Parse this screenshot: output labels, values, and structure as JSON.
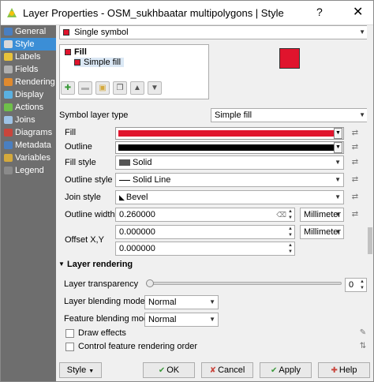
{
  "window": {
    "title": "Layer Properties - OSM_sukhbaatar multipolygons | Style",
    "help_glyph": "?",
    "close_glyph": "✕"
  },
  "sidebar": {
    "items": [
      {
        "label": "General",
        "icon": "info-icon",
        "active": false
      },
      {
        "label": "Style",
        "icon": "brush-icon",
        "active": true
      },
      {
        "label": "Labels",
        "icon": "labels-icon",
        "active": false
      },
      {
        "label": "Fields",
        "icon": "fields-icon",
        "active": false
      },
      {
        "label": "Rendering",
        "icon": "rendering-icon",
        "active": false
      },
      {
        "label": "Display",
        "icon": "display-icon",
        "active": false
      },
      {
        "label": "Actions",
        "icon": "actions-icon",
        "active": false
      },
      {
        "label": "Joins",
        "icon": "joins-icon",
        "active": false
      },
      {
        "label": "Diagrams",
        "icon": "diagrams-icon",
        "active": false
      },
      {
        "label": "Metadata",
        "icon": "metadata-icon",
        "active": false
      },
      {
        "label": "Variables",
        "icon": "variables-icon",
        "active": false
      },
      {
        "label": "Legend",
        "icon": "legend-icon",
        "active": false
      }
    ]
  },
  "renderer": {
    "selected": "Single symbol"
  },
  "symbol_tree": {
    "root_label": "Fill",
    "child_label": "Simple fill"
  },
  "preview_color": "#e0142d",
  "symbol_layer_type": {
    "label": "Symbol layer type",
    "value": "Simple fill"
  },
  "props": {
    "fill_label": "Fill",
    "fill_color": "#e0142d",
    "outline_label": "Outline",
    "outline_color": "#000000",
    "fill_style_label": "Fill style",
    "fill_style_value": "Solid",
    "outline_style_label": "Outline style",
    "outline_style_value": "Solid Line",
    "join_style_label": "Join style",
    "join_style_value": "Bevel",
    "outline_width_label": "Outline width",
    "outline_width_value": "0.260000",
    "outline_width_unit": "Millimeter",
    "offset_label": "Offset X,Y",
    "offset_x": "0.000000",
    "offset_y": "0.000000",
    "offset_unit": "Millimeter"
  },
  "layer_rendering": {
    "header": "Layer rendering",
    "transparency_label": "Layer transparency",
    "transparency_value": "0",
    "layer_blending_label": "Layer blending mode",
    "layer_blending_value": "Normal",
    "feature_blending_label": "Feature blending mode",
    "feature_blending_value": "Normal",
    "draw_effects_label": "Draw effects",
    "control_order_label": "Control feature rendering order"
  },
  "buttons": {
    "style": "Style",
    "ok": "OK",
    "cancel": "Cancel",
    "apply": "Apply",
    "help": "Help"
  }
}
